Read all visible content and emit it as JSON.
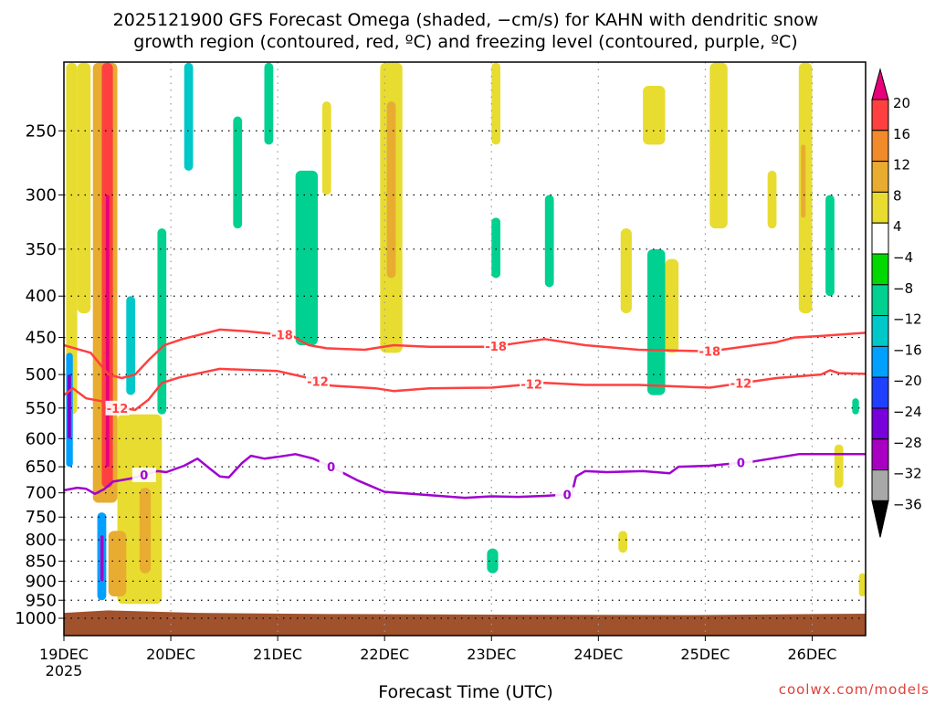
{
  "chart_data": {
    "type": "heatmap",
    "title_line1": "2025121900 GFS Forecast Omega (shaded, −cm/s) for KAHN with dendritic snow",
    "title_line2": "growth region (contoured, red, ºC) and freezing level (contoured, purple, ºC)",
    "xlabel": "Forecast Time (UTC)",
    "credit": "coolwx.com/models",
    "xlim_hours": [
      0,
      180
    ],
    "ylim_hpa": [
      1050,
      206
    ],
    "y_scale": "log-pressure",
    "grid": true,
    "x_ticks": [
      {
        "hour": 0,
        "label": "19DEC",
        "sub": "2025"
      },
      {
        "hour": 24,
        "label": "20DEC"
      },
      {
        "hour": 48,
        "label": "21DEC"
      },
      {
        "hour": 72,
        "label": "22DEC"
      },
      {
        "hour": 96,
        "label": "23DEC"
      },
      {
        "hour": 120,
        "label": "24DEC"
      },
      {
        "hour": 144,
        "label": "25DEC"
      },
      {
        "hour": 168,
        "label": "26DEC"
      }
    ],
    "y_ticks": [
      250,
      300,
      350,
      400,
      450,
      500,
      550,
      600,
      650,
      700,
      750,
      800,
      850,
      900,
      950,
      1000
    ],
    "colorbar": {
      "levels": [
        "20",
        "16",
        "12",
        "8",
        "4",
        "−4",
        "−8",
        "−12",
        "−16",
        "−20",
        "−24",
        "−28",
        "−32",
        "−36"
      ],
      "colors": [
        "#ff4040",
        "#f08a2a",
        "#e8ac30",
        "#e8dc30",
        "#ffffff",
        "#00d800",
        "#00d090",
        "#00c8c8",
        "#00a0ff",
        "#2040ff",
        "#7800d8",
        "#a800c0",
        "#a8a8a8"
      ],
      "top_arrow_color": "#e8007a",
      "bottom_arrow_color": "#000000"
    },
    "shading_cells": [
      {
        "h": [
          0.5,
          3
        ],
        "p": [
          206,
          560
        ],
        "v": 4
      },
      {
        "h": [
          0.5,
          2
        ],
        "p": [
          470,
          650
        ],
        "v": -16
      },
      {
        "h": [
          0.8,
          1.6
        ],
        "p": [
          500,
          600
        ],
        "v": -24
      },
      {
        "h": [
          6.5,
          12
        ],
        "p": [
          206,
          720
        ],
        "v": 8
      },
      {
        "h": [
          8.5,
          11
        ],
        "p": [
          206,
          690
        ],
        "v": 16
      },
      {
        "h": [
          9.4,
          10.2
        ],
        "p": [
          300,
          650
        ],
        "v": 20
      },
      {
        "h": [
          7.5,
          9.5
        ],
        "p": [
          740,
          950
        ],
        "v": -16
      },
      {
        "h": [
          8.2,
          8.9
        ],
        "p": [
          790,
          900
        ],
        "v": -28
      },
      {
        "h": [
          3,
          6
        ],
        "p": [
          206,
          420
        ],
        "v": 4
      },
      {
        "h": [
          12,
          22
        ],
        "p": [
          560,
          960
        ],
        "v": 4
      },
      {
        "h": [
          17,
          19.5
        ],
        "p": [
          690,
          880
        ],
        "v": 8
      },
      {
        "h": [
          10,
          14
        ],
        "p": [
          780,
          940
        ],
        "v": 8
      },
      {
        "h": [
          14,
          16
        ],
        "p": [
          400,
          530
        ],
        "v": -12
      },
      {
        "h": [
          21,
          23
        ],
        "p": [
          330,
          560
        ],
        "v": -8
      },
      {
        "h": [
          27,
          29
        ],
        "p": [
          206,
          280
        ],
        "v": -12
      },
      {
        "h": [
          38,
          40
        ],
        "p": [
          240,
          330
        ],
        "v": -8
      },
      {
        "h": [
          45,
          47
        ],
        "p": [
          206,
          260
        ],
        "v": -8
      },
      {
        "h": [
          52,
          57
        ],
        "p": [
          280,
          460
        ],
        "v": -8
      },
      {
        "h": [
          58,
          60
        ],
        "p": [
          230,
          300
        ],
        "v": 4
      },
      {
        "h": [
          71,
          76
        ],
        "p": [
          206,
          470
        ],
        "v": 4
      },
      {
        "h": [
          72.5,
          74.5
        ],
        "p": [
          230,
          380
        ],
        "v": 8
      },
      {
        "h": [
          96,
          98
        ],
        "p": [
          206,
          260
        ],
        "v": 4
      },
      {
        "h": [
          96,
          98
        ],
        "p": [
          320,
          380
        ],
        "v": -8
      },
      {
        "h": [
          108,
          110
        ],
        "p": [
          300,
          390
        ],
        "v": -8
      },
      {
        "h": [
          95,
          97.5
        ],
        "p": [
          820,
          880
        ],
        "v": -8
      },
      {
        "h": [
          125,
          127.5
        ],
        "p": [
          330,
          420
        ],
        "v": 4
      },
      {
        "h": [
          124.5,
          126.5
        ],
        "p": [
          780,
          830
        ],
        "v": 4
      },
      {
        "h": [
          130,
          135
        ],
        "p": [
          220,
          260
        ],
        "v": 4
      },
      {
        "h": [
          131,
          135
        ],
        "p": [
          350,
          530
        ],
        "v": -8
      },
      {
        "h": [
          135,
          138
        ],
        "p": [
          360,
          470
        ],
        "v": 4
      },
      {
        "h": [
          145,
          149
        ],
        "p": [
          206,
          330
        ],
        "v": 4
      },
      {
        "h": [
          158,
          160
        ],
        "p": [
          280,
          330
        ],
        "v": 4
      },
      {
        "h": [
          165,
          168
        ],
        "p": [
          206,
          420
        ],
        "v": 4
      },
      {
        "h": [
          165.5,
          166.5
        ],
        "p": [
          260,
          320
        ],
        "v": 8
      },
      {
        "h": [
          171,
          173
        ],
        "p": [
          300,
          400
        ],
        "v": -8
      },
      {
        "h": [
          173,
          175
        ],
        "p": [
          610,
          690
        ],
        "v": 4
      },
      {
        "h": [
          177,
          178.5
        ],
        "p": [
          535,
          560
        ],
        "v": -8
      },
      {
        "h": [
          178.5,
          180
        ],
        "p": [
          880,
          940
        ],
        "v": 4
      }
    ],
    "terrain": {
      "color": "#a0522d",
      "surface_hpa": [
        [
          0,
          985
        ],
        [
          10,
          978
        ],
        [
          30,
          985
        ],
        [
          60,
          988
        ],
        [
          100,
          990
        ],
        [
          140,
          991
        ],
        [
          180,
          987
        ]
      ]
    },
    "series": [
      {
        "name": "-18",
        "color": "#ff4040",
        "labels_at_hours": [
          49,
          97,
          145
        ],
        "points": [
          [
            0,
            460
          ],
          [
            3,
            465
          ],
          [
            6,
            470
          ],
          [
            10,
            500
          ],
          [
            13,
            505
          ],
          [
            16,
            500
          ],
          [
            19,
            480
          ],
          [
            22.5,
            460
          ],
          [
            26.6,
            452
          ],
          [
            35,
            440
          ],
          [
            41,
            442
          ],
          [
            48,
            446
          ],
          [
            51,
            447
          ],
          [
            55,
            460
          ],
          [
            59,
            464
          ],
          [
            67.5,
            466
          ],
          [
            74,
            460
          ],
          [
            82,
            462
          ],
          [
            96,
            462
          ],
          [
            108,
            452
          ],
          [
            117,
            460
          ],
          [
            129,
            466
          ],
          [
            145,
            468
          ],
          [
            160,
            456
          ],
          [
            164,
            450
          ],
          [
            170,
            448
          ],
          [
            180,
            444
          ]
        ]
      },
      {
        "name": "-12",
        "color": "#ff4040",
        "labels_at_hours": [
          12,
          57,
          105,
          152
        ],
        "points": [
          [
            0,
            530
          ],
          [
            2,
            520
          ],
          [
            5,
            535
          ],
          [
            9,
            540
          ],
          [
            11,
            550
          ],
          [
            13,
            550
          ],
          [
            16,
            553
          ],
          [
            19,
            537
          ],
          [
            22,
            512
          ],
          [
            26,
            504
          ],
          [
            35,
            492
          ],
          [
            48,
            495
          ],
          [
            55,
            505
          ],
          [
            60,
            516
          ],
          [
            70,
            520
          ],
          [
            74,
            524
          ],
          [
            82,
            520
          ],
          [
            96,
            519
          ],
          [
            108,
            512
          ],
          [
            117,
            515
          ],
          [
            129,
            515
          ],
          [
            145,
            519
          ],
          [
            160,
            505
          ],
          [
            170,
            500
          ],
          [
            172,
            494
          ],
          [
            174,
            498
          ],
          [
            180,
            499
          ]
        ]
      },
      {
        "name": "0",
        "color": "#a000d0",
        "labels_at_hours": [
          18,
          60,
          113,
          152
        ],
        "points": [
          [
            0,
            695
          ],
          [
            3,
            690
          ],
          [
            5,
            692
          ],
          [
            7,
            702
          ],
          [
            9,
            693
          ],
          [
            11,
            678
          ],
          [
            15,
            672
          ],
          [
            18,
            665
          ],
          [
            21,
            658
          ],
          [
            23,
            660
          ],
          [
            27,
            648
          ],
          [
            30,
            635
          ],
          [
            33,
            655
          ],
          [
            35,
            668
          ],
          [
            37,
            670
          ],
          [
            40,
            643
          ],
          [
            42,
            630
          ],
          [
            45,
            635
          ],
          [
            48,
            632
          ],
          [
            52,
            627
          ],
          [
            56,
            635
          ],
          [
            60,
            650
          ],
          [
            66,
            676
          ],
          [
            72,
            698
          ],
          [
            78,
            702
          ],
          [
            90,
            710
          ],
          [
            96,
            707
          ],
          [
            102,
            708
          ],
          [
            108,
            706
          ],
          [
            114,
            703
          ],
          [
            115,
            668
          ],
          [
            117,
            658
          ],
          [
            122,
            660
          ],
          [
            130,
            658
          ],
          [
            136,
            662
          ],
          [
            138,
            650
          ],
          [
            145,
            648
          ],
          [
            155,
            640
          ],
          [
            165,
            627
          ],
          [
            180,
            627
          ]
        ]
      }
    ]
  }
}
